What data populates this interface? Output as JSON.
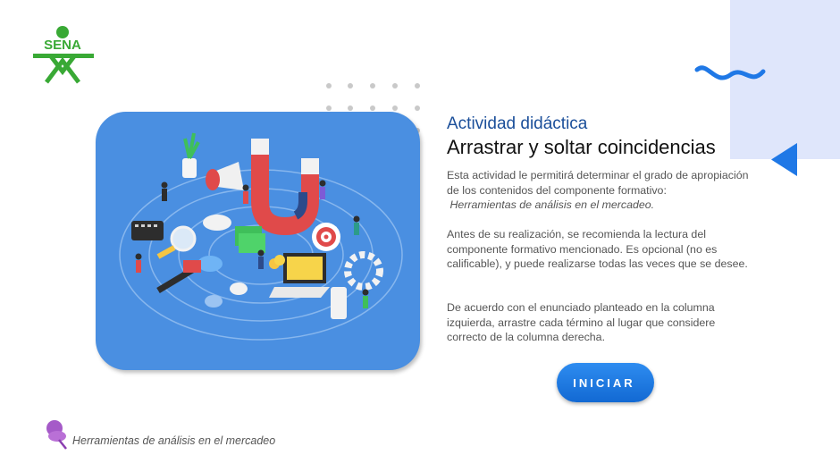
{
  "brand": {
    "logo_text": "SENA",
    "logo_color": "#39a935"
  },
  "header": {
    "subtitle": "Actividad didáctica",
    "title": "Arrastrar y soltar coincidencias"
  },
  "body": {
    "p1_text": "Esta actividad le permitirá determinar el grado de apropiación de los contenidos del componente formativo:",
    "p1_topic": "Herramientas de análisis en el mercadeo.",
    "p2": "Antes de su realización, se recomienda la lectura del componente formativo mencionado. Es opcional (no es calificable), y puede realizarse todas las veces que se desee.",
    "p3": "De acuerdo con el enunciado planteado en la columna izquierda, arrastre cada término al lugar que considere correcto de la columna derecha."
  },
  "actions": {
    "start_label": "INICIAR"
  },
  "footer": {
    "label": "Herramientas de análisis en el mercadeo"
  },
  "icons": {
    "wave": "wave-icon",
    "triangle": "triangle-left-icon",
    "pin": "pushpin-icon",
    "dots": "dot-grid-icon",
    "illustration": "marketing-analysis-illustration"
  },
  "colors": {
    "accent_blue": "#1f78e6",
    "title_blue": "#1b4f9a",
    "panel_bg": "#dfe6fb",
    "illustration_bg": "#4a8fe1",
    "pin_purple": "#a55ac8"
  }
}
